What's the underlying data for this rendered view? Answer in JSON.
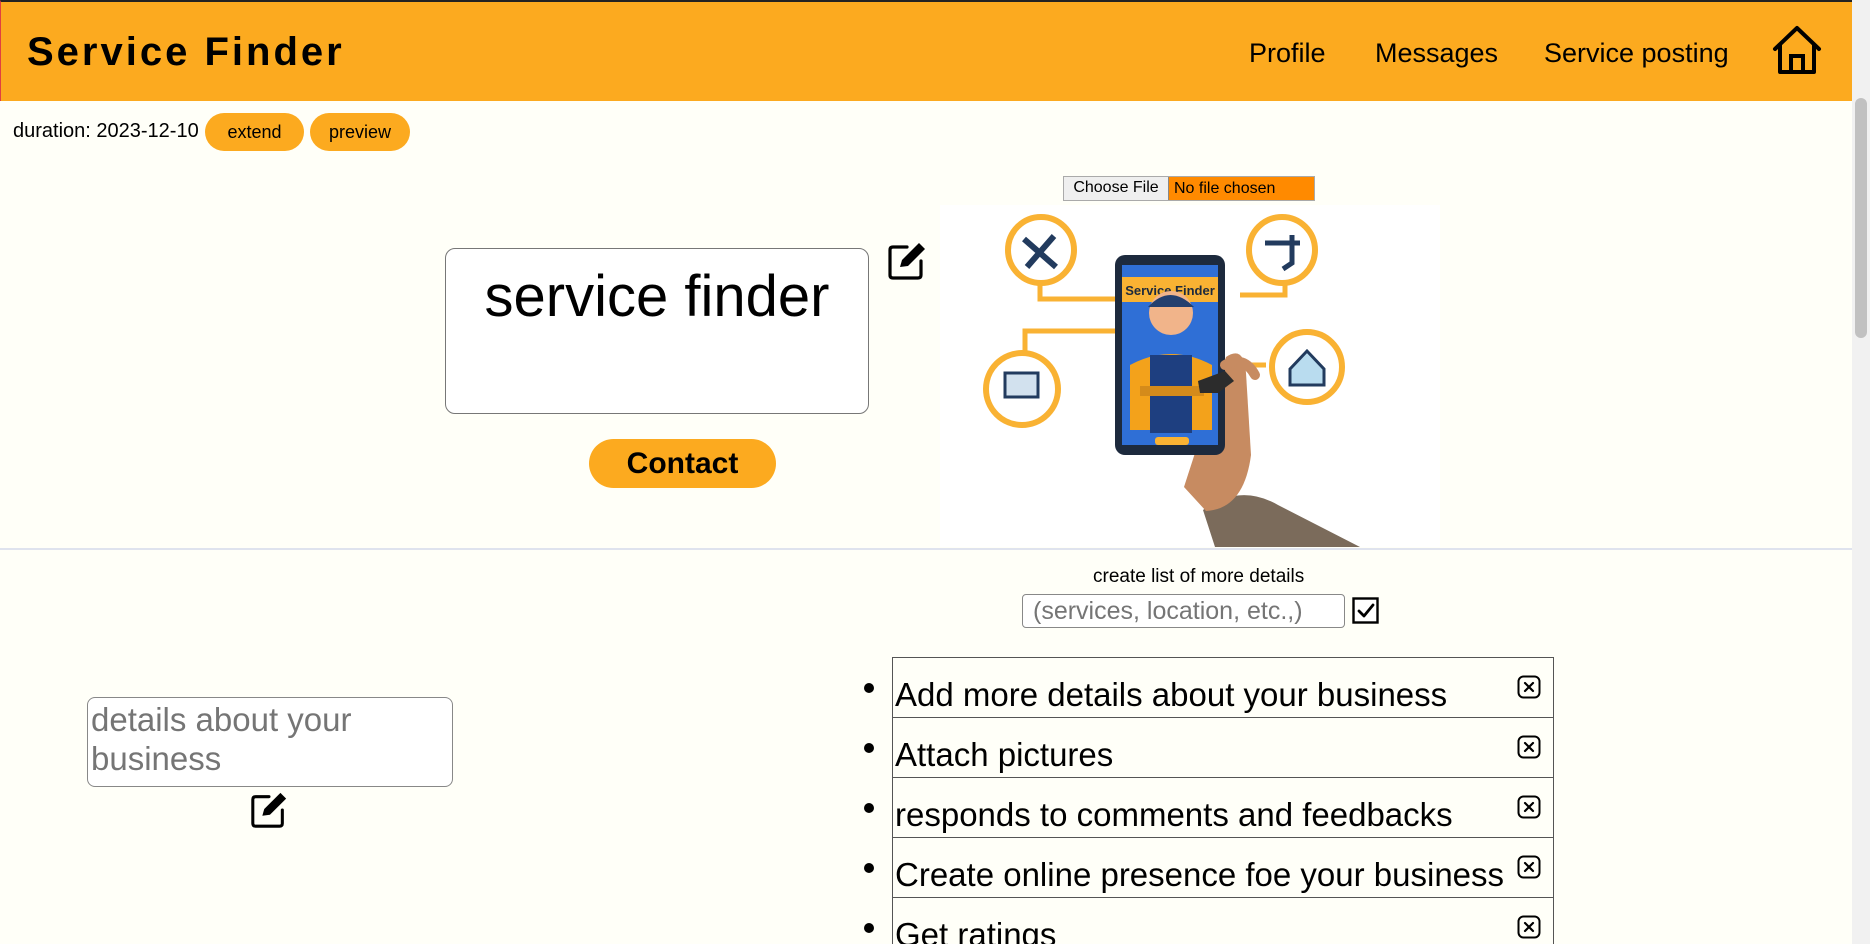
{
  "header": {
    "brand": "Service Finder",
    "nav": [
      "Profile",
      "Messages",
      "Service posting"
    ]
  },
  "toolbar": {
    "duration": "duration: 2023-12-10",
    "extend_label": "extend",
    "preview_label": "preview"
  },
  "upload": {
    "button_label": "Choose File",
    "status": "No file chosen"
  },
  "hero": {
    "title": "service finder",
    "contact_label": "Contact",
    "image_text": "Service Finder"
  },
  "list_builder": {
    "caption": "create list of more details",
    "placeholder": "(services, location, etc.,)"
  },
  "details": {
    "placeholder": "details about your business"
  },
  "features": [
    "Add more details about your business",
    "Attach pictures",
    "responds to comments and feedbacks",
    "Create online presence foe your business",
    "Get ratings"
  ],
  "colors": {
    "accent": "#fcaa1f",
    "file_input": "#ff8a00",
    "phone_screen": "#2f6fd6"
  }
}
